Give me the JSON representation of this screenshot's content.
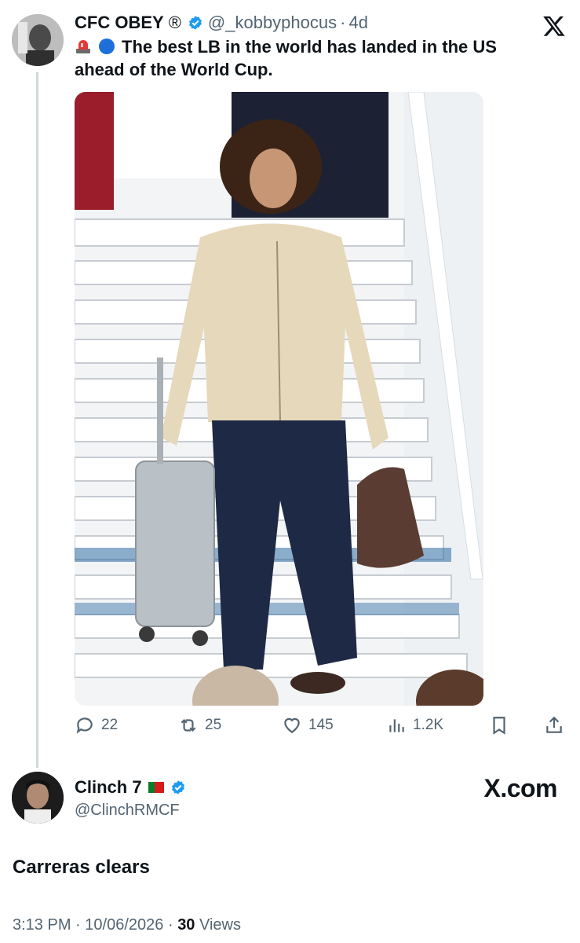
{
  "quoted_post": {
    "display_name": "CFC OBEY",
    "registered_mark": "®",
    "handle": "@_kobbyphocus",
    "separator": "·",
    "age": "4d",
    "text": "The best LB in the world has landed in the US ahead of the World Cup.",
    "emojis": [
      "siren-emoji",
      "blue-circle-emoji"
    ],
    "media": {
      "icon": "photo-player-on-airplane-stairs"
    },
    "actions": {
      "replies": "22",
      "reposts": "25",
      "likes": "145",
      "views": "1.2K"
    }
  },
  "reply_post": {
    "display_name": "Clinch 7",
    "handle": "@ClinchRMCF",
    "text": "Carreras clears",
    "timestamp": "3:13 PM",
    "date": "10/06/2026",
    "views_count": "30",
    "views_label": "Views",
    "separator": "·"
  },
  "branding": {
    "watermark": "X.com",
    "verified_color": "#1d9bf0",
    "muted_text_color": "#536471"
  }
}
